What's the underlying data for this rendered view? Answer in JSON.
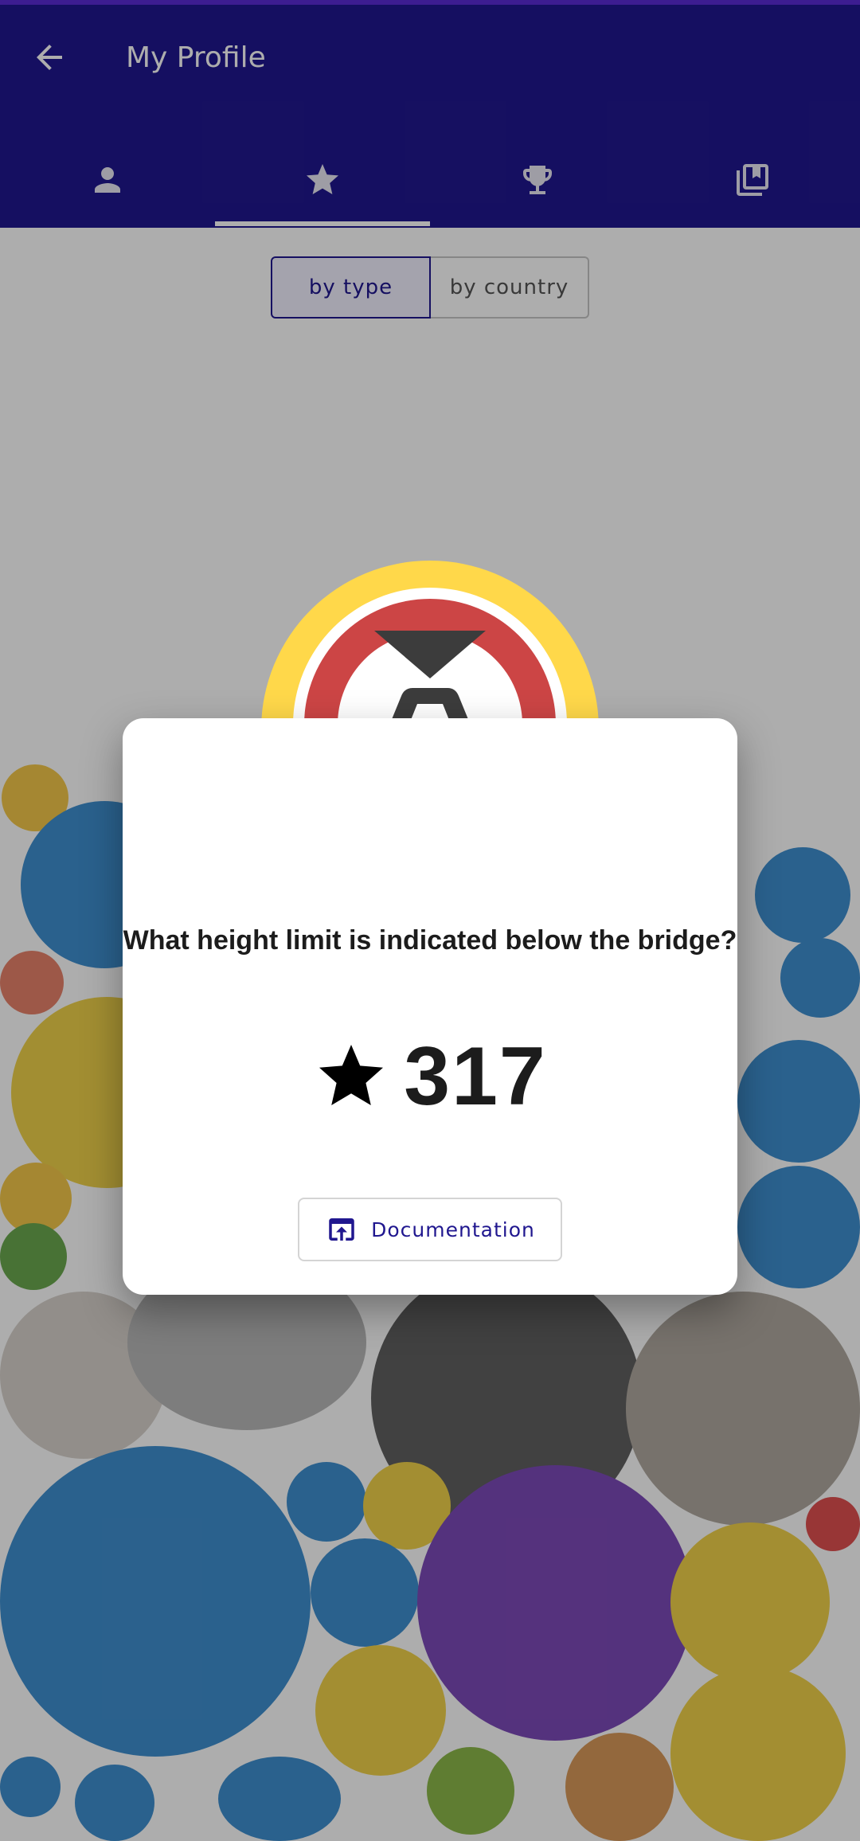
{
  "header": {
    "title": "My Profile",
    "back_icon": "arrow-left-icon"
  },
  "tabs": [
    {
      "icon": "person-icon"
    },
    {
      "icon": "star-icon",
      "selected": true
    },
    {
      "icon": "trophy-icon"
    },
    {
      "icon": "library-books-icon"
    }
  ],
  "toggle": {
    "by_type": "by type",
    "by_country": "by country",
    "selected": "by type"
  },
  "dialog": {
    "badge_icon": "height-limit-sign-icon",
    "question": "What height limit is indicated below the bridge?",
    "star_icon": "star-icon",
    "score": "317",
    "documentation_icon": "open-in-browser-icon",
    "documentation_label": "Documentation"
  },
  "colors": {
    "primary": "#20178f",
    "status_bar": "#5b2bd6",
    "badge_ring": "#ffd84a",
    "sign_red": "#cc4545",
    "sign_dark": "#3c3c3c"
  }
}
